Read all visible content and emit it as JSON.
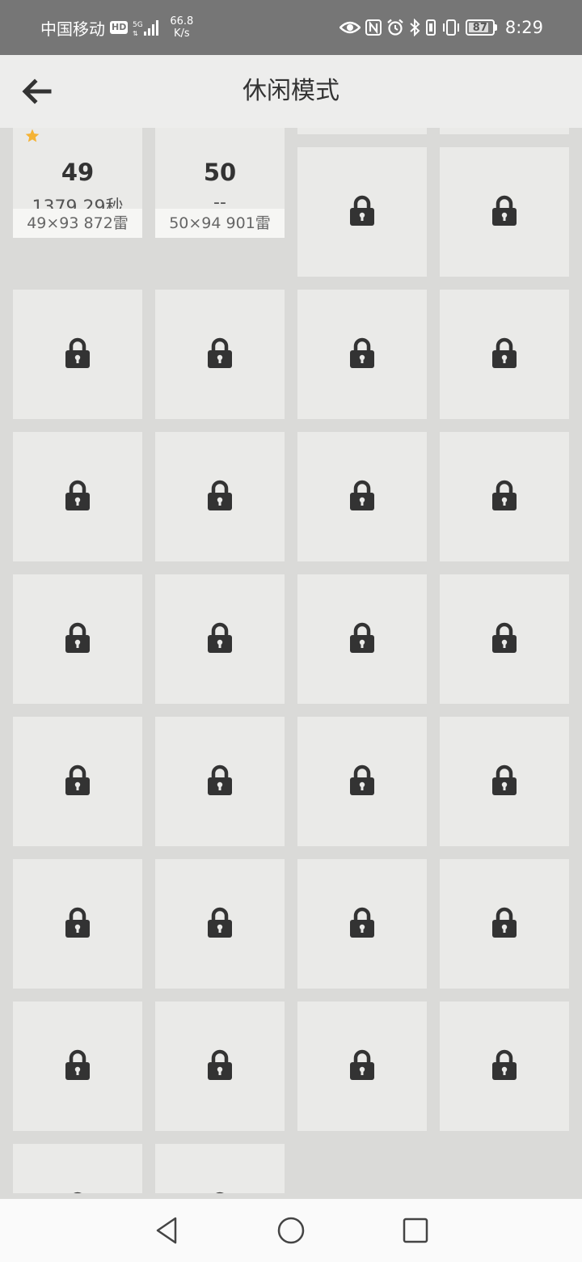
{
  "status_bar": {
    "carrier": "中国移动",
    "hd": "HD",
    "network": "5G",
    "speed_value": "66.8",
    "speed_unit": "K/s",
    "battery_percent": "87",
    "battery_level": 0.87,
    "time": "8:29"
  },
  "app_bar": {
    "title": "休闲模式",
    "back_icon": "arrow-left-icon"
  },
  "levels": [
    {
      "number": "49",
      "time": "1379.29秒",
      "info": "49×93  872雷",
      "starred": true,
      "locked": false
    },
    {
      "number": "50",
      "time": "--",
      "info": "50×94  901雷",
      "starred": false,
      "locked": false
    }
  ],
  "locked_tile_count": 30,
  "icons": {
    "lock": "lock-icon",
    "star": "star-icon"
  },
  "colors": {
    "star": "#f5b335",
    "lock": "#333333",
    "tile": "#eaeae8",
    "background": "#dadad8"
  },
  "nav_bar": {
    "back": "nav-back-icon",
    "home": "nav-home-icon",
    "recents": "nav-recents-icon"
  }
}
